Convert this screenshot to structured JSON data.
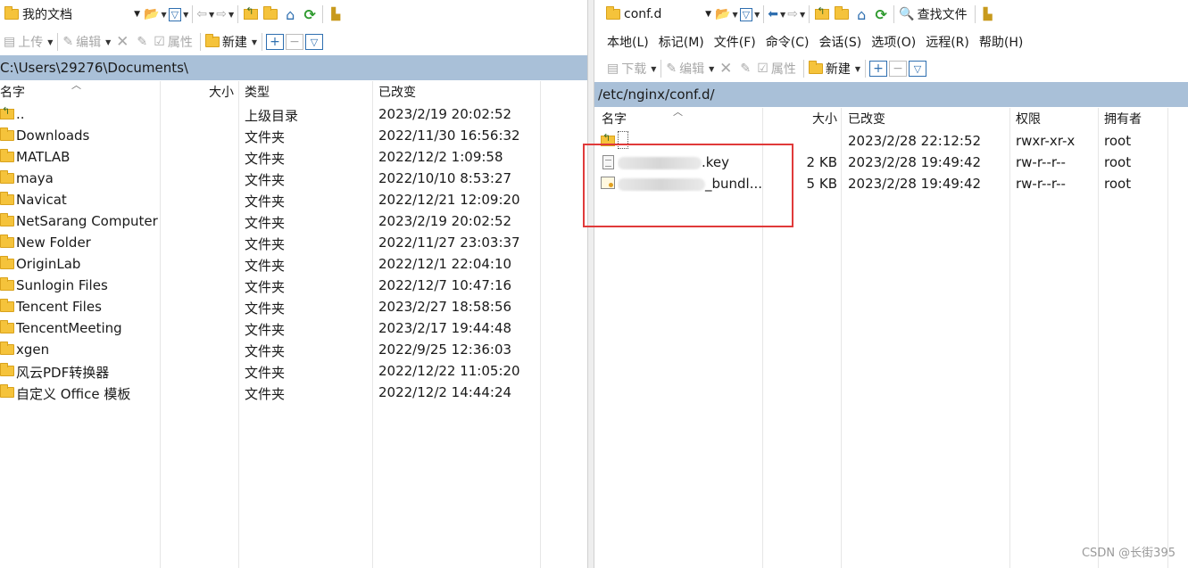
{
  "left": {
    "location_combo": "我的文档",
    "toolbar2": {
      "upload": "上传",
      "edit": "编辑",
      "properties": "属性",
      "new": "新建"
    },
    "path": "C:\\Users\\29276\\Documents\\",
    "columns": {
      "name": "名字",
      "size": "大小",
      "type": "类型",
      "modified": "已改变"
    },
    "rows": [
      {
        "name": "..",
        "type": "上级目录",
        "modified": "2023/2/19  20:02:52",
        "icon": "parent-folder-icon"
      },
      {
        "name": "Downloads",
        "type": "文件夹",
        "modified": "2022/11/30  16:56:32",
        "icon": "folder-icon"
      },
      {
        "name": "MATLAB",
        "type": "文件夹",
        "modified": "2022/12/2  1:09:58",
        "icon": "folder-icon"
      },
      {
        "name": "maya",
        "type": "文件夹",
        "modified": "2022/10/10  8:53:27",
        "icon": "folder-icon"
      },
      {
        "name": "Navicat",
        "type": "文件夹",
        "modified": "2022/12/21  12:09:20",
        "icon": "folder-icon"
      },
      {
        "name": "NetSarang Computer",
        "type": "文件夹",
        "modified": "2023/2/19  20:02:52",
        "icon": "folder-icon"
      },
      {
        "name": "New Folder",
        "type": "文件夹",
        "modified": "2022/11/27  23:03:37",
        "icon": "folder-icon"
      },
      {
        "name": "OriginLab",
        "type": "文件夹",
        "modified": "2022/12/1  22:04:10",
        "icon": "folder-icon"
      },
      {
        "name": "Sunlogin Files",
        "type": "文件夹",
        "modified": "2022/12/7  10:47:16",
        "icon": "folder-icon"
      },
      {
        "name": "Tencent Files",
        "type": "文件夹",
        "modified": "2023/2/27  18:58:56",
        "icon": "folder-icon"
      },
      {
        "name": "TencentMeeting",
        "type": "文件夹",
        "modified": "2023/2/17  19:44:48",
        "icon": "folder-icon"
      },
      {
        "name": "xgen",
        "type": "文件夹",
        "modified": "2022/9/25  12:36:03",
        "icon": "folder-icon"
      },
      {
        "name": "风云PDF转换器",
        "type": "文件夹",
        "modified": "2022/12/22  11:05:20",
        "icon": "folder-icon"
      },
      {
        "name": "自定义 Office 模板",
        "type": "文件夹",
        "modified": "2022/12/2  14:44:24",
        "icon": "folder-icon"
      }
    ]
  },
  "right": {
    "location_combo": "conf.d",
    "find_files": "查找文件",
    "menu": [
      "本地(L)",
      "标记(M)",
      "文件(F)",
      "命令(C)",
      "会话(S)",
      "选项(O)",
      "远程(R)",
      "帮助(H)"
    ],
    "toolbar2": {
      "download": "下载",
      "edit": "编辑",
      "properties": "属性",
      "new": "新建"
    },
    "path": "/etc/nginx/conf.d/",
    "columns": {
      "name": "名字",
      "size": "大小",
      "modified": "已改变",
      "permissions": "权限",
      "owner": "拥有者"
    },
    "rows": [
      {
        "name": "",
        "size": "",
        "modified": "2023/2/28 22:12:52",
        "permissions": "rwxr-xr-x",
        "owner": "root",
        "icon": "parent-folder-icon"
      },
      {
        "name": ".key",
        "size": "2 KB",
        "modified": "2023/2/28 19:49:42",
        "permissions": "rw-r--r--",
        "owner": "root",
        "icon": "file-icon"
      },
      {
        "name": "_bundl...",
        "size": "5 KB",
        "modified": "2023/2/28 19:49:42",
        "permissions": "rw-r--r--",
        "owner": "root",
        "icon": "certificate-icon"
      }
    ]
  },
  "watermark": "CSDN @长街395",
  "colors": {
    "path_bar": "#a9c0d8",
    "highlight_box": "#e03a3a",
    "folder": "#f5c33b"
  }
}
